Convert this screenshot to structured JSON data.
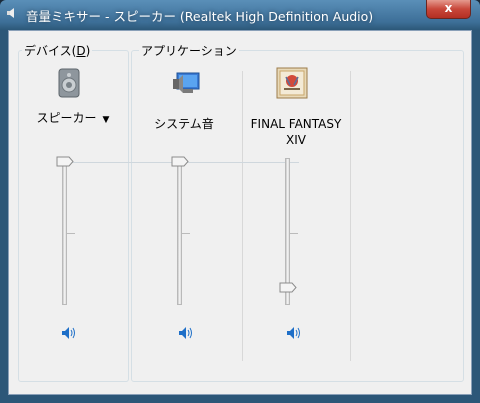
{
  "window": {
    "title": "音量ミキサー - スピーカー (Realtek High Definition Audio)",
    "close_label": "x"
  },
  "device_group": {
    "label_prefix": "デバイス(",
    "label_accel": "D",
    "label_suffix": ")",
    "device_name": "スピーカー",
    "volume": 1.0
  },
  "app_group": {
    "label": "アプリケーション",
    "apps": [
      {
        "name": "システム音",
        "volume": 1.0
      },
      {
        "name_line1": "FINAL FANTASY",
        "name_line2": "XIV",
        "volume": 0.1
      }
    ]
  },
  "icons": {
    "device": "speaker-device-icon",
    "system_sounds": "system-sounds-icon",
    "game": "final-fantasy-xiv-icon",
    "mute": "speaker-volume-icon"
  },
  "colors": {
    "accent": "#1e7ad6"
  }
}
